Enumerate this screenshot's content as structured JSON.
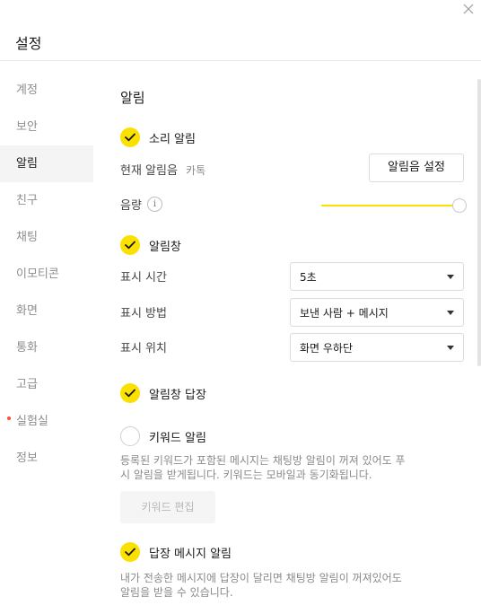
{
  "window": {
    "title": "설정",
    "close_icon": "close-icon"
  },
  "sidebar": {
    "items": [
      {
        "label": "계정",
        "active": false
      },
      {
        "label": "보안",
        "active": false
      },
      {
        "label": "알림",
        "active": true
      },
      {
        "label": "친구",
        "active": false
      },
      {
        "label": "채팅",
        "active": false
      },
      {
        "label": "이모티콘",
        "active": false
      },
      {
        "label": "화면",
        "active": false
      },
      {
        "label": "통화",
        "active": false
      },
      {
        "label": "고급",
        "active": false
      },
      {
        "label": "실험실",
        "active": false,
        "badge_dot": true
      },
      {
        "label": "정보",
        "active": false
      }
    ]
  },
  "main": {
    "section_title": "알림",
    "sound": {
      "label": "소리 알림",
      "checked": true,
      "current_sound_label": "현재 알림음",
      "current_sound_value": "카톡",
      "set_button": "알림음 설정",
      "volume_label": "음량",
      "info_glyph": "i",
      "volume_level": 1.0
    },
    "popup": {
      "label": "알림창",
      "checked": true,
      "duration_label": "표시 시간",
      "duration_value": "5초",
      "method_label": "표시 방법",
      "method_value": "보낸 사람 + 메시지",
      "position_label": "표시 위치",
      "position_value": "화면 우하단"
    },
    "popup_reply": {
      "label": "알림창 답장",
      "checked": true
    },
    "keyword": {
      "label": "키워드 알림",
      "checked": false,
      "desc_line1": "등록된 키워드가 포함된 메시지는 채팅방 알림이 꺼져 있어도 푸",
      "desc_line2": "시 알림을 받게됩니다. 키워드는 모바일과 동기화됩니다.",
      "edit_button": "키워드 편집"
    },
    "reply_message": {
      "label": "답장 메시지 알림",
      "checked": true,
      "desc_line1": "내가 전송한 메시지에 답장이 달리면 채팅방 알림이 꺼져있어도",
      "desc_line2": "알림을 받을 수 있습니다."
    }
  },
  "colors": {
    "accent": "#fae100",
    "badge": "#ff4b3a",
    "active_bg": "#f4f4f4"
  }
}
